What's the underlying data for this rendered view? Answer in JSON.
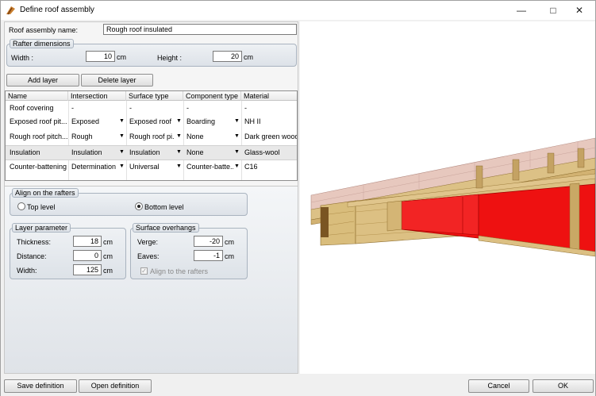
{
  "window": {
    "title": "Define roof assembly",
    "icon": "roof-assembly-icon",
    "controls": [
      "minimize-icon",
      "maximize-icon",
      "close-icon"
    ]
  },
  "assembly": {
    "name_label": "Roof assembly name:",
    "name_value": "Rough roof insulated"
  },
  "rafter": {
    "group_title": "Rafter dimensions",
    "width_label": "Width :",
    "width_value": "10",
    "width_unit": "cm",
    "height_label": "Height :",
    "height_value": "20",
    "height_unit": "cm"
  },
  "toolbar": {
    "add_layer": "Add layer",
    "delete_layer": "Delete layer"
  },
  "layers": {
    "columns": [
      "Name",
      "Intersection",
      "Surface type",
      "Component type",
      "Material"
    ],
    "rows": [
      {
        "name": "Roof covering",
        "intersection": "-",
        "surface": "-",
        "component": "-",
        "material": "-"
      },
      {
        "name": "Exposed roof pit...",
        "intersection": "Exposed",
        "surface": "Exposed roof",
        "component": "Boarding",
        "material": "NH II"
      },
      {
        "name": "Rough roof pitch...",
        "intersection": "Rough",
        "surface": "Rough roof pi...",
        "component": "None",
        "material": "Dark green wood"
      },
      {
        "name": "Insulation",
        "intersection": "Insulation",
        "surface": "Insulation",
        "component": "None",
        "material": "Glass-wool"
      },
      {
        "name": "Counter-battening",
        "intersection": "Determination",
        "surface": "Universal",
        "component": "Counter-batte...",
        "material": "C16"
      }
    ],
    "selected_row": 3
  },
  "align": {
    "group_title": "Align on the rafters",
    "top_label": "Top level",
    "bottom_label": "Bottom level",
    "selected": "bottom"
  },
  "layer_param": {
    "group_title": "Layer parameter",
    "thickness_label": "Thickness:",
    "thickness_value": "18",
    "distance_label": "Distance:",
    "distance_value": "0",
    "width_label": "Width:",
    "width_value": "125",
    "unit": "cm"
  },
  "overhang": {
    "group_title": "Surface overhangs",
    "verge_label": "Verge:",
    "verge_value": "-20",
    "eaves_label": "Eaves:",
    "eaves_value": "-1",
    "unit": "cm",
    "align_label": "Align to the rafters",
    "align_checked": true
  },
  "footer": {
    "save": "Save definition",
    "open": "Open definition",
    "cancel": "Cancel",
    "ok": "OK"
  },
  "colors": {
    "insulation": "#ee1111",
    "wood": "#d9bd7c",
    "roof_covering": "#e7c8be"
  }
}
